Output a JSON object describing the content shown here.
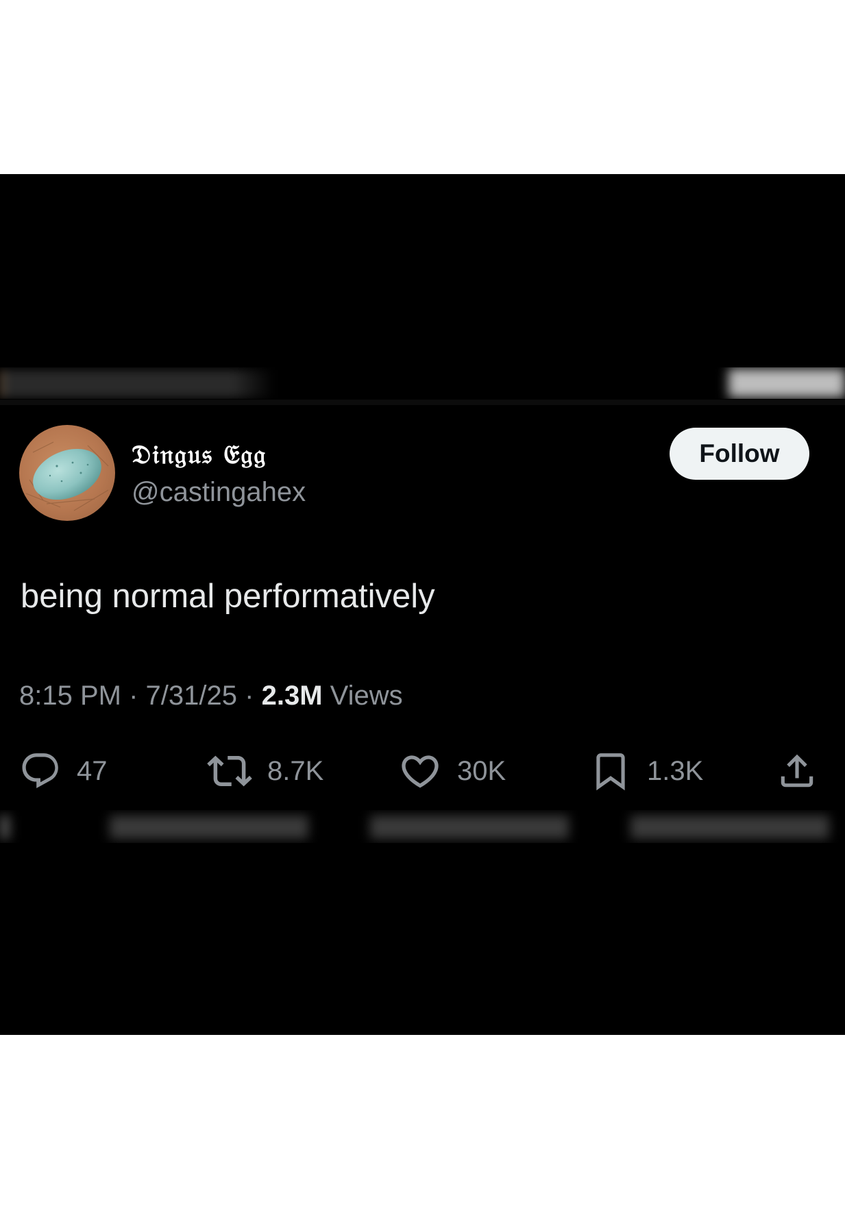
{
  "tweet": {
    "author": {
      "display_name": "𝔇𝔦𝔫𝔤𝔲𝔰 𝔈𝔤𝔤",
      "handle": "@castingahex",
      "avatar_icon": "egg-avatar"
    },
    "follow_label": "Follow",
    "text": "being normal performatively",
    "meta": {
      "time": "8:15 PM",
      "separator": "·",
      "date": "7/31/25",
      "views_count": "2.3M",
      "views_label": "Views"
    },
    "actions": {
      "replies": {
        "icon": "reply-icon",
        "count": "47"
      },
      "retweets": {
        "icon": "retweet-icon",
        "count": "8.7K"
      },
      "likes": {
        "icon": "heart-icon",
        "count": "30K"
      },
      "bookmarks": {
        "icon": "bookmark-icon",
        "count": "1.3K"
      },
      "share": {
        "icon": "share-icon"
      }
    }
  },
  "colors": {
    "background": "#000000",
    "page": "#ffffff",
    "text_primary": "#e7e9ea",
    "text_secondary": "#8f949a",
    "follow_button_bg": "#eff3f4",
    "follow_button_text": "#0f1419"
  }
}
